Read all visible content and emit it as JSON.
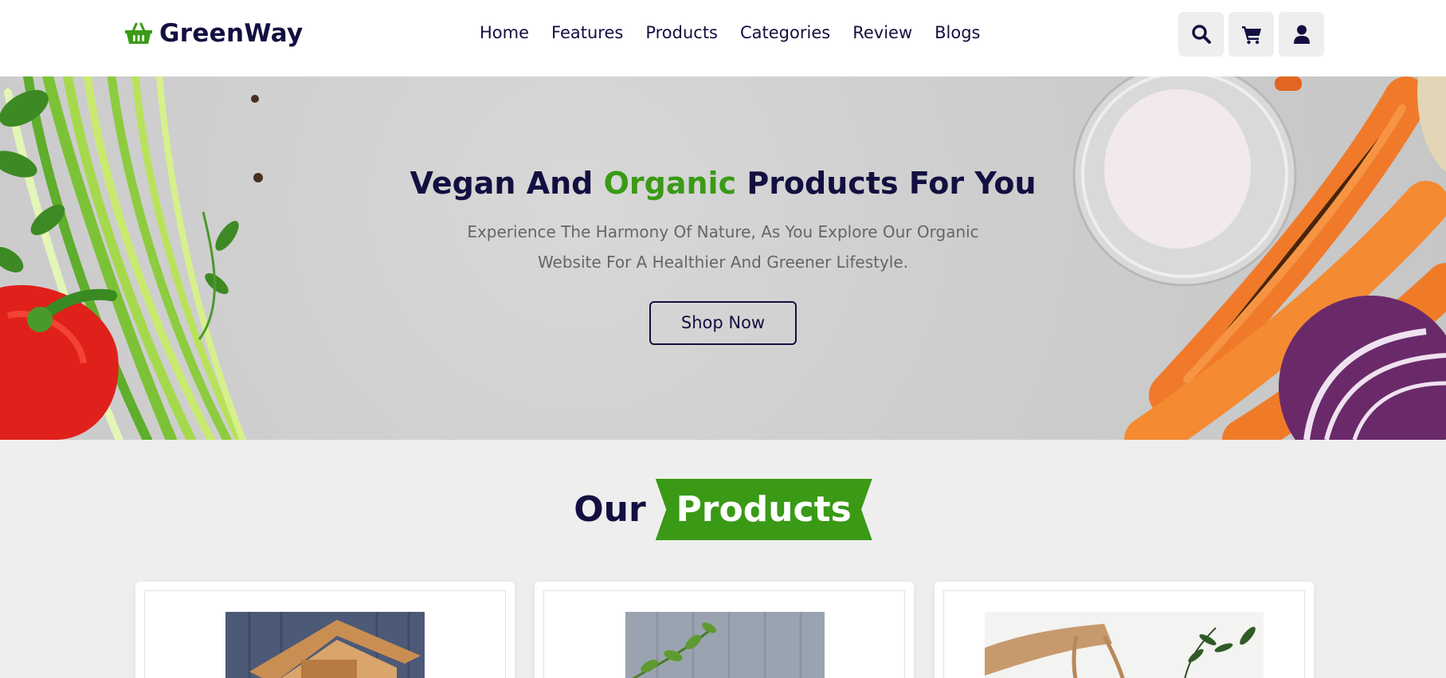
{
  "brand": {
    "name": "GreenWay",
    "icon": "shopping-basket-icon",
    "accent_color": "#3a9a16",
    "text_color": "#130f40"
  },
  "nav": {
    "items": [
      {
        "label": "Home"
      },
      {
        "label": "Features"
      },
      {
        "label": "Products"
      },
      {
        "label": "Categories"
      },
      {
        "label": "Review"
      },
      {
        "label": "Blogs"
      }
    ]
  },
  "header_icons": [
    "search-icon",
    "cart-icon",
    "user-icon"
  ],
  "hero": {
    "title_before": "Vegan And ",
    "title_accent": "Organic",
    "title_after": " Products For You",
    "subtitle": "Experience The Harmony Of Nature, As You Explore Our Organic Website For A Healthier And Greener Lifestyle.",
    "button": "Shop Now"
  },
  "products_section": {
    "heading_plain": "Our",
    "heading_ribbon": "Products",
    "cards": [
      {
        "image": "wooden-birdhouse-image"
      },
      {
        "image": "plant-wall-image"
      },
      {
        "image": "tote-bag-image"
      }
    ]
  }
}
